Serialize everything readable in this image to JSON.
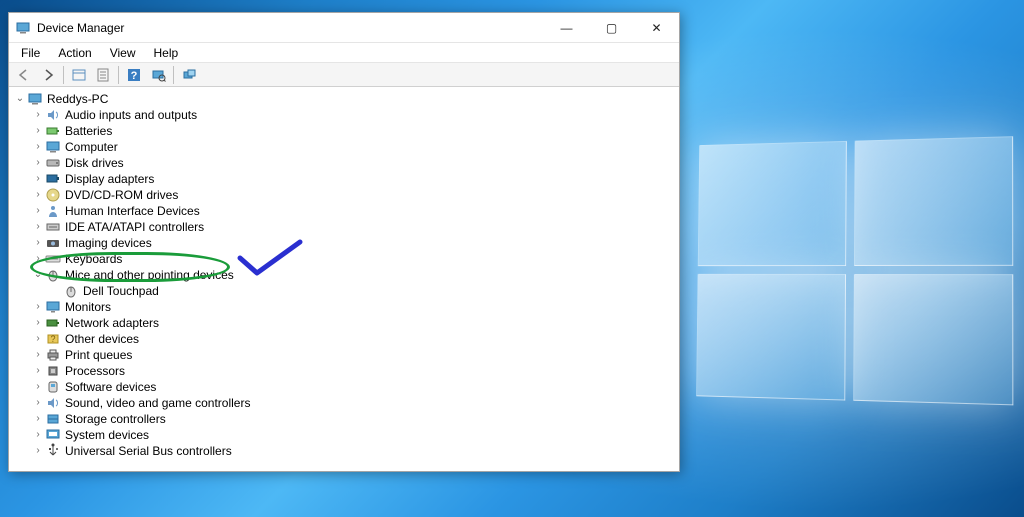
{
  "window": {
    "title": "Device Manager",
    "controls": {
      "min": "—",
      "max": "▢",
      "close": "✕"
    }
  },
  "menubar": {
    "file": "File",
    "action": "Action",
    "view": "View",
    "help": "Help"
  },
  "toolbar": {
    "back": "◄",
    "forward": "►",
    "props": "▦",
    "refresh": "▧",
    "help": "❔",
    "scan": "🖵",
    "remote": "⚙"
  },
  "tree": {
    "root": {
      "label": "Reddys-PC",
      "expanded": true
    },
    "categories": [
      {
        "label": "Audio inputs and outputs",
        "expanded": false,
        "icon": "audio"
      },
      {
        "label": "Batteries",
        "expanded": false,
        "icon": "battery"
      },
      {
        "label": "Computer",
        "expanded": false,
        "icon": "computer"
      },
      {
        "label": "Disk drives",
        "expanded": false,
        "icon": "disk"
      },
      {
        "label": "Display adapters",
        "expanded": false,
        "icon": "display"
      },
      {
        "label": "DVD/CD-ROM drives",
        "expanded": false,
        "icon": "dvd"
      },
      {
        "label": "Human Interface Devices",
        "expanded": false,
        "icon": "hid"
      },
      {
        "label": "IDE ATA/ATAPI controllers",
        "expanded": false,
        "icon": "ide"
      },
      {
        "label": "Imaging devices",
        "expanded": false,
        "icon": "imaging"
      },
      {
        "label": "Keyboards",
        "expanded": false,
        "icon": "keyboard"
      },
      {
        "label": "Mice and other pointing devices",
        "expanded": true,
        "icon": "mouse",
        "children": [
          {
            "label": "Dell Touchpad",
            "icon": "mouse"
          }
        ]
      },
      {
        "label": "Monitors",
        "expanded": false,
        "icon": "monitor"
      },
      {
        "label": "Network adapters",
        "expanded": false,
        "icon": "network"
      },
      {
        "label": "Other devices",
        "expanded": false,
        "icon": "other"
      },
      {
        "label": "Print queues",
        "expanded": false,
        "icon": "printer"
      },
      {
        "label": "Processors",
        "expanded": false,
        "icon": "cpu"
      },
      {
        "label": "Software devices",
        "expanded": false,
        "icon": "software"
      },
      {
        "label": "Sound, video and game controllers",
        "expanded": false,
        "icon": "sound"
      },
      {
        "label": "Storage controllers",
        "expanded": false,
        "icon": "storage"
      },
      {
        "label": "System devices",
        "expanded": false,
        "icon": "system"
      },
      {
        "label": "Universal Serial Bus controllers",
        "expanded": false,
        "icon": "usb"
      }
    ]
  }
}
